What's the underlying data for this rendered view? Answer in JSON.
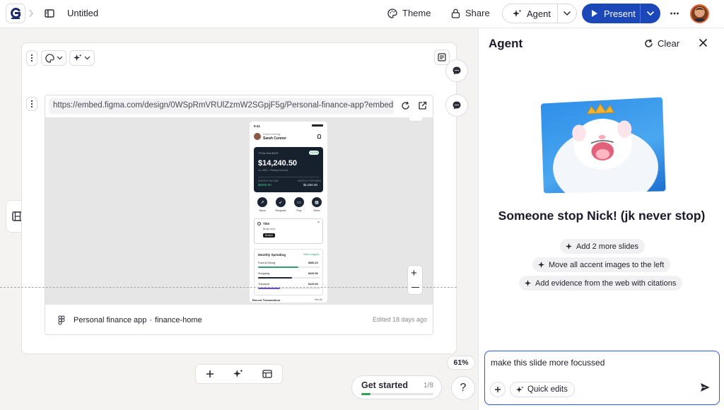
{
  "topbar": {
    "doc_title": "Untitled",
    "theme_label": "Theme",
    "share_label": "Share",
    "agent_label": "Agent",
    "present_label": "Present"
  },
  "embed": {
    "url": "https://embed.figma.com/design/0WSpRmVRUlZzmW2SGpjF5g/Personal-finance-app?embed...",
    "file_name": "Personal finance app",
    "separator": "·",
    "frame_name": "finance-home",
    "edited": "Edited 18 days ago"
  },
  "phone": {
    "time": "9:41",
    "greeting": "Good morning,",
    "user": "Sarah Connor",
    "balance_label": "TOTAL BALANCE",
    "balance_badge": "+3.2%",
    "balance": "$14,240.50",
    "account": "•••• 4821 • Primary Account",
    "income_label": "MONTHLY INCOME",
    "income": "$6000.00",
    "expense_label": "MONTHLY EXPENSES",
    "expense": "$1,620.40",
    "actions": [
      "Send",
      "Request",
      "Pay",
      "More"
    ],
    "note_title": "Title",
    "note_body": "Body text.",
    "note_button": "Button",
    "spending_title": "Monthly Spending",
    "spending_link": "View Insights",
    "spending": [
      {
        "label": "Food & Dining",
        "amount": "$580.20",
        "fill": 0.65,
        "color": "#2e9e72"
      },
      {
        "label": "Shopping",
        "amount": "$420.50",
        "fill": 0.55,
        "color": "#1b2533"
      },
      {
        "label": "Transport",
        "amount": "$120.30",
        "fill": 0.35,
        "color": "#6a4bd6"
      }
    ],
    "recent_title": "Recent Transactions",
    "recent_link": "See All"
  },
  "canvas": {
    "zoom": "61%",
    "get_started": "Get started",
    "progress": "1/8",
    "progress_fraction": 0.125,
    "help": "?"
  },
  "agent": {
    "title": "Agent",
    "clear_label": "Clear",
    "headline": "Someone stop Nick! (jk never stop)",
    "suggestions": [
      "Add 2 more slides",
      "Move all accent images to the left",
      "Add evidence from the web with citations"
    ],
    "composer_text": "make this slide more focussed",
    "quick_edits": "Quick edits"
  },
  "colors": {
    "accent": "#1c47b8",
    "composer_border": "#2a58d6",
    "background": "#f4f3f1"
  }
}
